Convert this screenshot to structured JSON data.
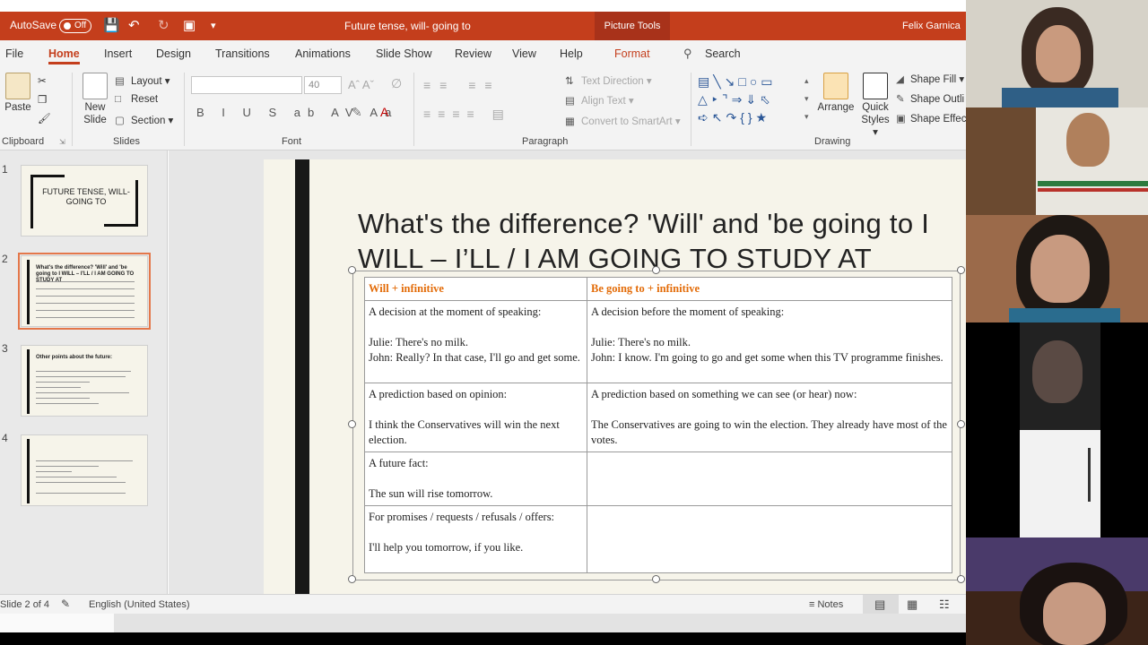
{
  "titlebar": {
    "autosave_label": "AutoSave",
    "autosave_state": "Off",
    "doc_title": "Future tense, will- going to",
    "context_tab": "Picture Tools",
    "user_name": "Felix Garnica",
    "accent": "#c43e1c"
  },
  "menu": {
    "file": "File",
    "home": "Home",
    "insert": "Insert",
    "design": "Design",
    "transitions": "Transitions",
    "animations": "Animations",
    "slideshow": "Slide Show",
    "review": "Review",
    "view": "View",
    "help": "Help",
    "format": "Format",
    "search": "Search"
  },
  "ribbon": {
    "clipboard": {
      "label": "Clipboard",
      "paste": "Paste"
    },
    "slides": {
      "label": "Slides",
      "new_slide_1": "New",
      "new_slide_2": "Slide",
      "layout": "Layout",
      "reset": "Reset",
      "section": "Section"
    },
    "font": {
      "label": "Font",
      "size": "40",
      "buttons": "B I U S ab AV Aa"
    },
    "paragraph": {
      "label": "Paragraph",
      "text_direction": "Text Direction",
      "align_text": "Align Text",
      "convert": "Convert to SmartArt"
    },
    "drawing": {
      "label": "Drawing",
      "arrange": "Arrange",
      "quick_styles_1": "Quick",
      "quick_styles_2": "Styles",
      "shape_fill": "Shape Fill",
      "shape_outline": "Shape Outli",
      "shape_effects": "Shape Effec"
    }
  },
  "thumbnails": [
    {
      "num": "1",
      "title": "FUTURE TENSE, WILL- GOING TO"
    },
    {
      "num": "2",
      "title": "What's the difference? 'Will' and 'be going to I WILL – I'LL / I AM GOING TO STUDY AT"
    },
    {
      "num": "3",
      "title": "Other points about the future:"
    },
    {
      "num": "4",
      "title": ""
    }
  ],
  "slide": {
    "title": "What's the difference? 'Will' and 'be going to I WILL – I’LL / I AM GOING TO STUDY AT",
    "table": {
      "headers": [
        "Will + infinitive",
        "Be going to + infinitive"
      ],
      "rows": [
        {
          "left": [
            "A decision at the moment of speaking:",
            "Julie: There's no milk.",
            "John: Really? In that case, I'll go and get some."
          ],
          "right": [
            "A decision before the moment of speaking:",
            "Julie: There's no milk.",
            "John: I know. I'm going to go and get some when this TV programme finishes."
          ]
        },
        {
          "left": [
            "A prediction based on opinion:",
            "I think the Conservatives will win the next election."
          ],
          "right": [
            "A prediction based on something we can see (or hear) now:",
            "The Conservatives are going to win the election. They already have most of the votes."
          ]
        },
        {
          "left": [
            "A future fact:",
            "The sun will rise tomorrow."
          ],
          "right": []
        },
        {
          "left": [
            "For promises / requests / refusals / offers:",
            "I'll help you tomorrow, if you like."
          ],
          "right": []
        }
      ]
    }
  },
  "status": {
    "slide_counter": "Slide 2 of 4",
    "language": "English (United States)",
    "notes": "Notes"
  }
}
